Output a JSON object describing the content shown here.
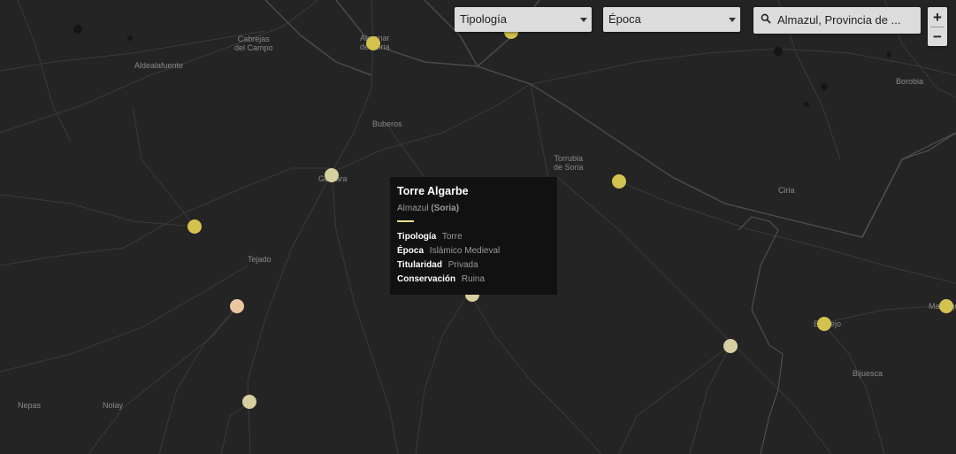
{
  "map": {
    "places": [
      {
        "name": "Cabrejas\ndel Campo"
      },
      {
        "name": "Aldealafuente"
      },
      {
        "name": "Almenar\nde Soria"
      },
      {
        "name": "Buberos"
      },
      {
        "name": "Gómara"
      },
      {
        "name": "Torrubia\nde Soria"
      },
      {
        "name": "Ciria"
      },
      {
        "name": "Borobia"
      },
      {
        "name": "Tejado"
      },
      {
        "name": "Nepas"
      },
      {
        "name": "Nolay"
      },
      {
        "name": "Bijuesca"
      },
      {
        "name": "Berdejo"
      },
      {
        "name": "Malanquilla"
      }
    ],
    "marker_colors": {
      "yellow": "#d4c24f",
      "pale": "#d6cfa0",
      "peach": "#e8c7a0"
    }
  },
  "filters": {
    "tipologia_label": "Tipología",
    "epoca_label": "Época"
  },
  "search": {
    "value": "Almazul, Provincia de ...",
    "icon": "search-icon"
  },
  "zoom": {
    "in_label": "+",
    "out_label": "−"
  },
  "popup": {
    "title": "Torre Algarbe",
    "location": "Almazul",
    "province": "(Soria)",
    "fields": [
      {
        "key": "Tipología",
        "value": "Torre"
      },
      {
        "key": "Época",
        "value": "Islámico Medieval"
      },
      {
        "key": "Titularidad",
        "value": "Privada"
      },
      {
        "key": "Conservación",
        "value": "Ruina"
      }
    ],
    "accent": "#e8df8a"
  }
}
